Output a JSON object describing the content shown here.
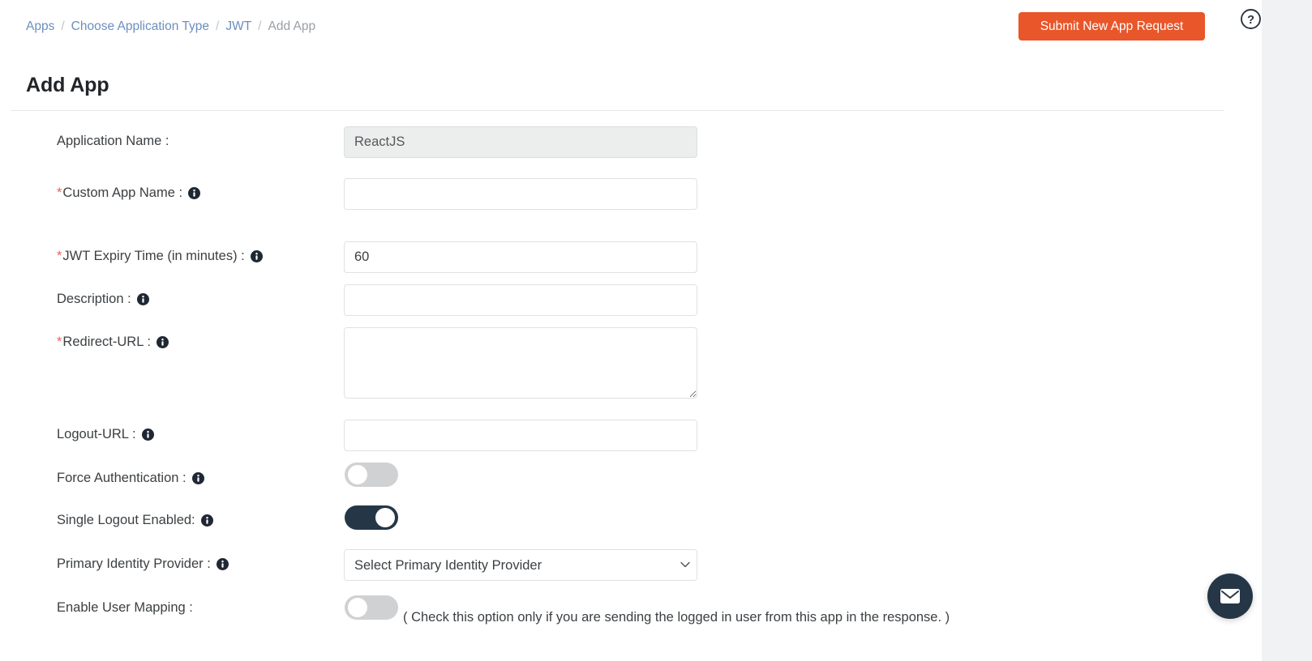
{
  "breadcrumb": {
    "items": [
      {
        "label": "Apps",
        "link": true
      },
      {
        "label": "Choose Application Type",
        "link": true
      },
      {
        "label": "JWT",
        "link": true
      },
      {
        "label": "Add App",
        "link": false
      }
    ],
    "separator": "/"
  },
  "header": {
    "submit_button_label": "Submit New App Request",
    "help_icon": "question-mark-circle-icon",
    "page_title": "Add App"
  },
  "colors": {
    "accent_orange": "#e8562a",
    "link_blue": "#6c8ebf",
    "toggle_on": "#253746",
    "toggle_off": "#cfd1d3",
    "required_red": "#e8615b"
  },
  "form": {
    "fields": [
      {
        "key": "application_name",
        "label": "Application Name :",
        "required": false,
        "has_info_icon": false,
        "type": "text",
        "value": "ReactJS",
        "placeholder": "",
        "disabled": true
      },
      {
        "key": "custom_app_name",
        "label": "Custom App Name :",
        "required": true,
        "has_info_icon": true,
        "type": "text",
        "value": "",
        "placeholder": "",
        "disabled": false
      },
      {
        "key": "jwt_expiry_time",
        "label": "JWT Expiry Time (in minutes) :",
        "required": true,
        "has_info_icon": true,
        "type": "text",
        "value": "60",
        "placeholder": "",
        "disabled": false
      },
      {
        "key": "description",
        "label": "Description :",
        "required": false,
        "has_info_icon": true,
        "type": "text",
        "value": "",
        "placeholder": "",
        "disabled": false
      },
      {
        "key": "redirect_url",
        "label": "Redirect-URL :",
        "required": true,
        "has_info_icon": true,
        "type": "textarea",
        "value": "",
        "placeholder": "",
        "disabled": false
      },
      {
        "key": "logout_url",
        "label": "Logout-URL :",
        "required": false,
        "has_info_icon": true,
        "type": "text",
        "value": "",
        "placeholder": "",
        "disabled": false
      },
      {
        "key": "force_authentication",
        "label": "Force Authentication :",
        "required": false,
        "has_info_icon": true,
        "type": "toggle",
        "value": "off"
      },
      {
        "key": "single_logout_enabled",
        "label": "Single Logout Enabled:",
        "required": false,
        "has_info_icon": true,
        "type": "toggle",
        "value": "on"
      },
      {
        "key": "primary_identity_provider",
        "label": "Primary Identity Provider :",
        "required": false,
        "has_info_icon": true,
        "type": "select",
        "selected_option": "Select Primary Identity Provider"
      },
      {
        "key": "enable_user_mapping",
        "label": "Enable User Mapping :",
        "required": false,
        "has_info_icon": false,
        "type": "toggle",
        "value": "off",
        "helper_text": "( Check this option only if you are sending the logged in user from this app in the response. )"
      }
    ]
  },
  "chat_widget": {
    "icon": "envelope-icon"
  }
}
